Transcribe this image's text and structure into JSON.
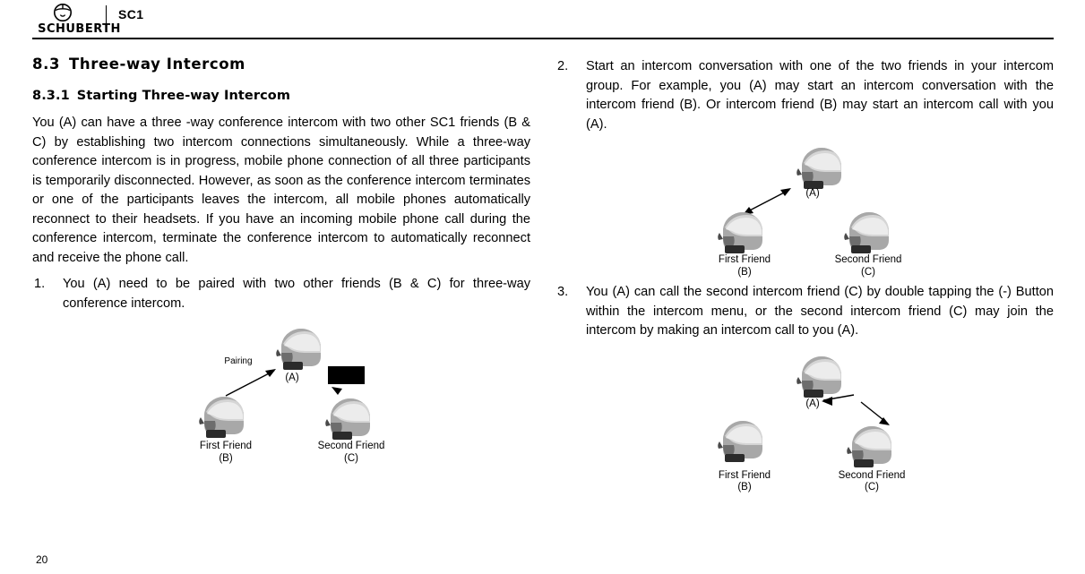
{
  "header": {
    "brand": "SCHUBERTH",
    "model": "SC1",
    "logo_icon": "schuberth-logo-icon"
  },
  "left_column": {
    "section_number": "8.3",
    "section_title": "Three-way Intercom",
    "subsection_number": "8.3.1",
    "subsection_title": "Starting Three-way Intercom",
    "intro_paragraph": "You (A) can have a three -way conference intercom with two other SC1 friends (B & C) by establishing two intercom connections simultaneously. While a three-way conference intercom is in progress, mobile phone connection of all three participants is temporarily disconnected. However, as soon as the conference intercom terminates or one of the participants leaves the intercom, all mobile phones automatically reconnect to their headsets. If you have an incoming mobile phone call during the conference intercom, terminate the conference intercom to automatically reconnect and receive the phone call.",
    "step1_number": "1.",
    "step1_text": "You (A) need to be paired with two other friends (B & C) for three-way conference intercom.",
    "figure1": {
      "pairing_label": "Pairing",
      "label_a": "(A)",
      "label_b": "First Friend\n(B)",
      "label_c": "Second Friend\n(C)"
    }
  },
  "right_column": {
    "step2_number": "2.",
    "step2_text": "Start an intercom conversation with one of the two friends in your intercom group. For example, you (A) may start an intercom conversation with the intercom friend (B). Or intercom friend (B) may start an intercom call with you (A).",
    "figure2": {
      "label_a": "(A)",
      "label_b": "First Friend\n(B)",
      "label_c": "Second Friend\n(C)"
    },
    "step3_number": "3.",
    "step3_text": "You (A) can call the second intercom friend (C) by double tapping the (-) Button within the intercom menu, or the second intercom friend (C) may join the intercom by making an intercom call to you (A).",
    "figure3": {
      "label_a": "(A)",
      "label_b": "First Friend\n(B)",
      "label_c": "Second Friend\n(C)"
    }
  },
  "footer": {
    "page_number": "20"
  }
}
